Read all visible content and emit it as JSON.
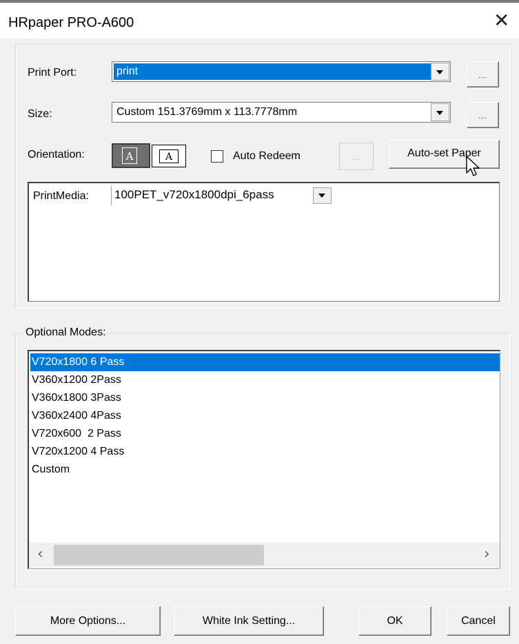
{
  "window": {
    "title": "HRpaper PRO-A600",
    "close_icon": "close-icon"
  },
  "print_port": {
    "label": "Print Port:",
    "value": "print",
    "browse": "..."
  },
  "size": {
    "label": "Size:",
    "value": "Custom 151.3769mm x 113.7778mm",
    "browse": "..."
  },
  "orientation": {
    "label": "Orientation:",
    "portrait_glyph": "A",
    "landscape_glyph": "A",
    "selected": "portrait"
  },
  "auto_redeem": {
    "label": "Auto Redeem",
    "checked": false,
    "browse": "..."
  },
  "auto_set_paper": {
    "label": "Auto-set Paper"
  },
  "print_media": {
    "label": "PrintMedia:",
    "value": "100PET_v720x1800dpi_6pass"
  },
  "optional_modes": {
    "label": "Optional Modes:",
    "selected_index": 0,
    "items": [
      "V720x1800 6 Pass",
      "V360x1200 2Pass",
      "V360x1800 3Pass",
      "V360x2400 4Pass",
      "V720x600  2 Pass",
      "V720x1200 4 Pass",
      "Custom"
    ],
    "scroll_left": "‹",
    "scroll_right": "›"
  },
  "buttons": {
    "more_options": "More Options...",
    "white_ink": "White Ink Setting...",
    "ok": "OK",
    "cancel": "Cancel"
  },
  "colors": {
    "selection": "#0078d7",
    "dialog_bg": "#f0f0f0"
  }
}
